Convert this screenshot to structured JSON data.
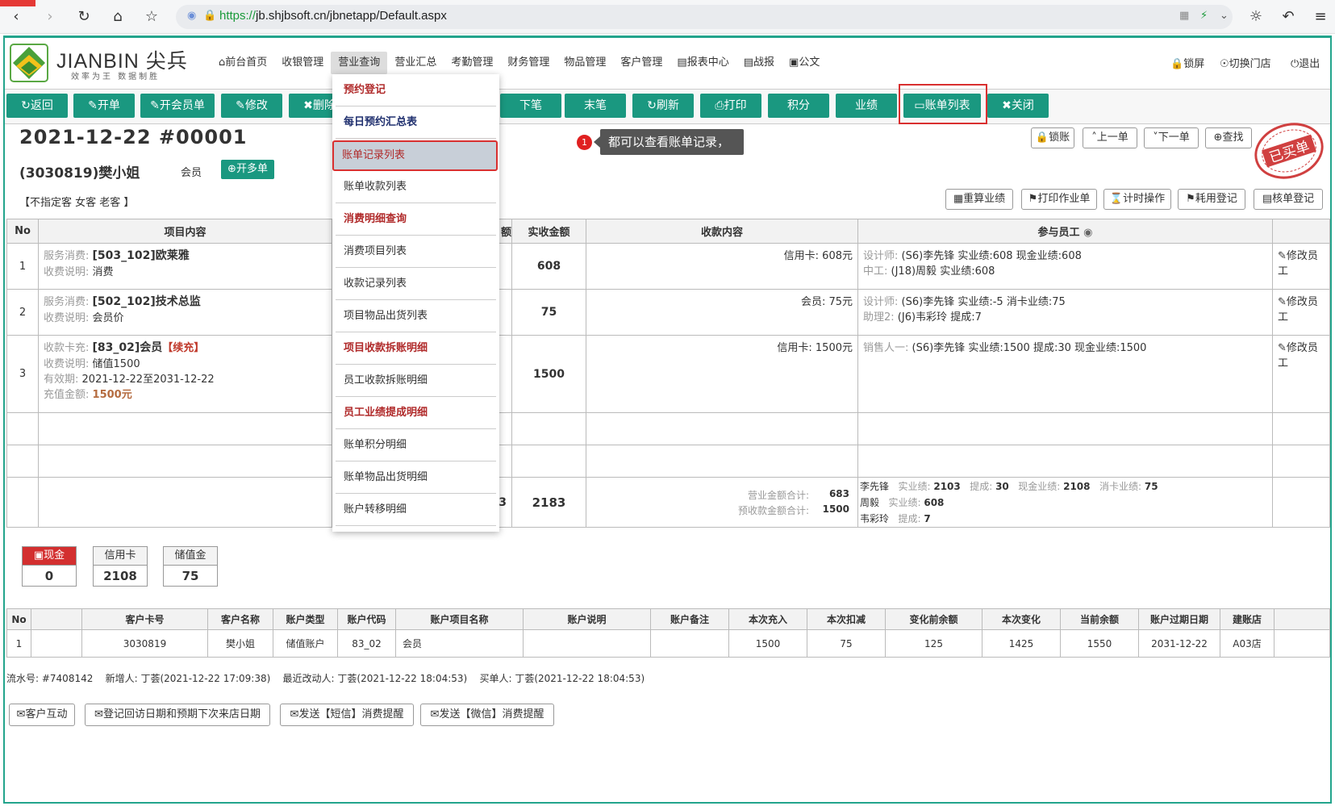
{
  "browser": {
    "url_scheme": "https://",
    "url_rest": "jb.shjbsoft.cn/jbnetapp/Default.aspx"
  },
  "header": {
    "logo_text": "JIANBIN 尖兵",
    "logo_sub": "效率为王 数据制胜",
    "nav": [
      "前台首页",
      "收银管理",
      "营业查询",
      "营业汇总",
      "考勤管理",
      "财务管理",
      "物品管理",
      "客户管理",
      "报表中心",
      "战报",
      "公文"
    ],
    "right": [
      "锁屏",
      "切换门店",
      "退出"
    ]
  },
  "toolbar": {
    "buttons": [
      "返回",
      "开单",
      "开会员单",
      "修改",
      "删除",
      "下笔",
      "末笔",
      "刷新",
      "打印",
      "积分",
      "业绩",
      "账单列表",
      "关闭"
    ]
  },
  "ticket": {
    "title": "2021-12-22  #00001",
    "customer": "(3030819)樊小姐",
    "member_type": "会员",
    "open_multi": "开多单",
    "tags": "【不指定客 女客 老客 】",
    "stamp": "已买单"
  },
  "tooltip": {
    "badge": "1",
    "text": "都可以查看账单记录，"
  },
  "right_buttons": {
    "top": [
      "锁账",
      "上一单",
      "下一单",
      "查找"
    ],
    "second": [
      "重算业绩",
      "打印作业单",
      "计时操作",
      "耗用登记",
      "核单登记"
    ]
  },
  "main_table": {
    "headers": [
      "No",
      "项目内容",
      "额",
      "实收金额",
      "收款内容",
      "参与员工"
    ],
    "rows": [
      {
        "no": "1",
        "lines": [
          [
            "服务消费:",
            "[503_102]欧莱雅"
          ],
          [
            "收费说明:",
            "消费"
          ]
        ],
        "amount": "608",
        "payment": "信用卡:  608元",
        "staff": [
          [
            "设计师:",
            "(S6)李先锋",
            "实业绩:608 现金业绩:608"
          ],
          [
            " 中工:",
            "(J18)周毅",
            "实业绩:608"
          ]
        ],
        "action": "修改员工"
      },
      {
        "no": "2",
        "lines": [
          [
            "服务消费:",
            "[502_102]技术总监"
          ],
          [
            "收费说明:",
            "会员价"
          ]
        ],
        "amount": "75",
        "payment": "会员:   75元",
        "staff": [
          [
            "设计师:",
            "(S6)李先锋",
            "实业绩:-5 消卡业绩:75"
          ],
          [
            "助理2:",
            "(J6)韦彩玲",
            "提成:7"
          ]
        ],
        "action": "修改员工"
      },
      {
        "no": "3",
        "lines": [
          [
            "收款卡充:",
            "[83_02]会员",
            "【续充】"
          ],
          [
            "收费说明:",
            "储值1500"
          ],
          [
            "有效期:",
            "2021-12-22至2031-12-22"
          ],
          [
            "充值金额:",
            "1500元"
          ]
        ],
        "amount": "1500",
        "payment": "信用卡:  1500元",
        "staff": [
          [
            "销售人一:",
            "(S6)李先锋",
            "实业绩:1500 提成:30 现金业绩:1500"
          ]
        ],
        "action": "修改员工"
      }
    ],
    "total": {
      "amount": "2183",
      "frag": "3",
      "labels": [
        "营业金额合计:",
        "预收款金额合计:"
      ],
      "values": [
        "683",
        "1500"
      ],
      "staff": [
        {
          "name": "李先锋",
          "items": [
            [
              "实业绩:",
              "2103"
            ],
            [
              "提成:",
              "30"
            ],
            [
              "现金业绩:",
              "2108"
            ],
            [
              "消卡业绩:",
              "75"
            ]
          ]
        },
        {
          "name": "周毅",
          "items": [
            [
              "实业绩:",
              "608"
            ]
          ]
        },
        {
          "name": "韦彩玲",
          "items": [
            [
              "提成:",
              "7"
            ]
          ]
        }
      ]
    }
  },
  "payments": [
    {
      "label": "现金",
      "value": "0"
    },
    {
      "label": "信用卡",
      "value": "2108"
    },
    {
      "label": "储值金",
      "value": "75"
    }
  ],
  "account_table": {
    "headers": [
      "No",
      "",
      "客户卡号",
      "客户名称",
      "账户类型",
      "账户代码",
      "账户项目名称",
      "账户说明",
      "账户备注",
      "本次充入",
      "本次扣减",
      "变化前余额",
      "本次变化",
      "当前余额",
      "账户过期日期",
      "建账店",
      ""
    ],
    "rows": [
      [
        "1",
        "",
        "3030819",
        "樊小姐",
        "储值账户",
        "83_02",
        "会员",
        "",
        "",
        "1500",
        "75",
        "125",
        "1425",
        "1550",
        "2031-12-22",
        "A03店",
        ""
      ]
    ]
  },
  "footer": {
    "info": "流水号: #7408142    新增人: 丁荟(2021-12-22 17:09:38)    最近改动人: 丁荟(2021-12-22 18:04:53)    买单人: 丁荟(2021-12-22 18:04:53)",
    "buttons": [
      "客户互动",
      "登记回访日期和预期下次来店日期",
      "发送【短信】消费提醒",
      "发送【微信】消费提醒"
    ]
  },
  "dropdown": {
    "items": [
      {
        "label": "预约登记",
        "type": "head"
      },
      {
        "label": "每日预约汇总表",
        "type": "navy"
      },
      {
        "label": "账单记录列表",
        "type": "sel"
      },
      {
        "label": "账单收款列表",
        "type": "item"
      },
      {
        "label": "消费明细查询",
        "type": "head"
      },
      {
        "label": "消费项目列表",
        "type": "item"
      },
      {
        "label": "收款记录列表",
        "type": "item"
      },
      {
        "label": "项目物品出货列表",
        "type": "item"
      },
      {
        "label": "项目收款拆账明细",
        "type": "head"
      },
      {
        "label": "员工收款拆账明细",
        "type": "item"
      },
      {
        "label": "员工业绩提成明细",
        "type": "head"
      },
      {
        "label": "账单积分明细",
        "type": "item"
      },
      {
        "label": "账单物品出货明细",
        "type": "item"
      },
      {
        "label": "账户转移明细",
        "type": "item"
      }
    ]
  },
  "colors": {
    "accent": "#1a9880",
    "highlight_red": "#d93030",
    "frame": "#23a48c"
  }
}
